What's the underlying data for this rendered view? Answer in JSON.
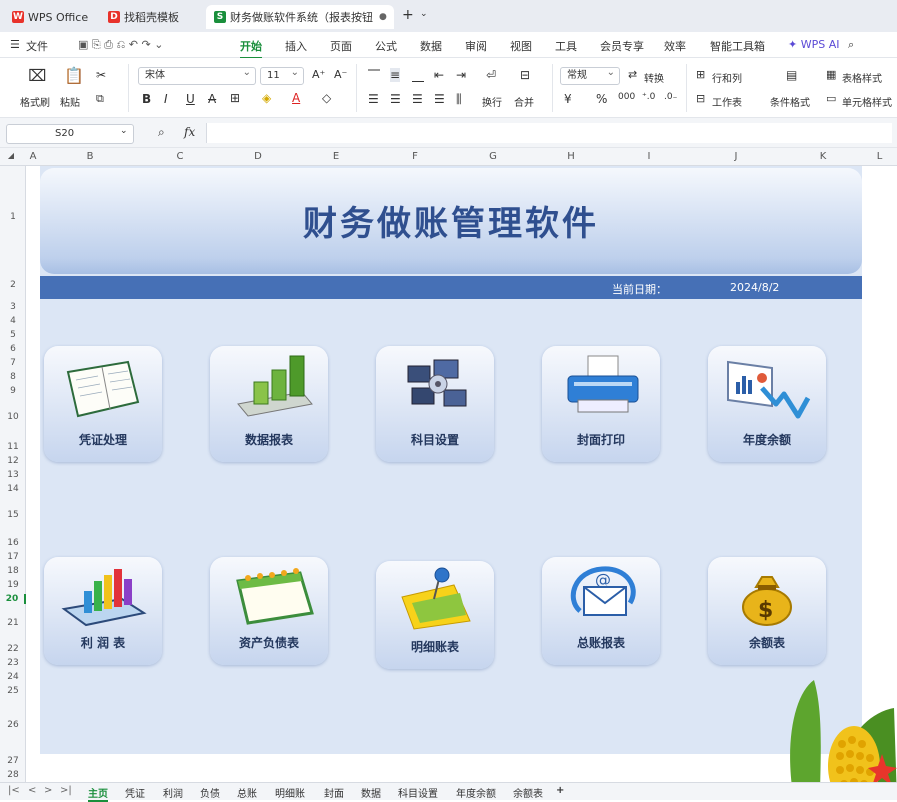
{
  "window_tabs": [
    {
      "label": "WPS Office",
      "icon": "W",
      "color": "#e8322b"
    },
    {
      "label": "找稻壳模板",
      "icon": "D",
      "color": "#e8322b"
    },
    {
      "label": "财务做账软件系统（报表按钮",
      "icon": "S",
      "color": "#1a8f3c"
    }
  ],
  "menu": {
    "file": "文件",
    "items": [
      "开始",
      "插入",
      "页面",
      "公式",
      "数据",
      "审阅",
      "视图",
      "工具",
      "会员专享",
      "效率",
      "智能工具箱"
    ],
    "active": "开始",
    "ai": "WPS AI"
  },
  "ribbon": {
    "format_painter": "格式刷",
    "paste": "粘贴",
    "font_name": "宋体",
    "font_size": "11",
    "wrap": "换行",
    "merge": "合并",
    "number_format": "常规",
    "convert": "转换",
    "row_col": "行和列",
    "worksheet": "工作表",
    "cond_format": "条件格式",
    "table_style": "表格样式",
    "cell_style": "单元格样式"
  },
  "formula_bar": {
    "cell_ref": "S20",
    "fx": "fx"
  },
  "columns": [
    "A",
    "B",
    "C",
    "D",
    "E",
    "F",
    "G",
    "H",
    "I",
    "J",
    "K",
    "L"
  ],
  "rows": [
    "1",
    "2",
    "3",
    "4",
    "5",
    "6",
    "7",
    "8",
    "9",
    "10",
    "11",
    "12",
    "13",
    "14",
    "15",
    "16",
    "17",
    "18",
    "19",
    "20",
    "21",
    "22",
    "23",
    "24",
    "25",
    "26",
    "27",
    "28"
  ],
  "selected_row": "20",
  "dashboard": {
    "title": "财务做账管理软件",
    "date_label": "当前日期：",
    "date_value": "2024/8/2",
    "buttons": [
      {
        "label": "凭证处理",
        "icon": "ledger-book-icon"
      },
      {
        "label": "数据报表",
        "icon": "bar-chart-3d-icon"
      },
      {
        "label": "科目设置",
        "icon": "settings-screens-icon"
      },
      {
        "label": "封面打印",
        "icon": "printer-icon"
      },
      {
        "label": "年度余额",
        "icon": "trend-chart-icon"
      },
      {
        "label": "利 润 表",
        "icon": "bar-graph-icon"
      },
      {
        "label": "资产负债表",
        "icon": "calendar-icon"
      },
      {
        "label": "明细账表",
        "icon": "sticky-note-pin-icon"
      },
      {
        "label": "总账报表",
        "icon": "email-at-icon"
      },
      {
        "label": "余额表",
        "icon": "money-bag-icon"
      }
    ]
  },
  "sheet_tabs": [
    "主页",
    "凭证",
    "利润",
    "负债",
    "总账",
    "明细账",
    "封面",
    "数据",
    "科目设置",
    "年度余额",
    "余额表"
  ],
  "active_sheet": "主页",
  "add_sheet": "+"
}
